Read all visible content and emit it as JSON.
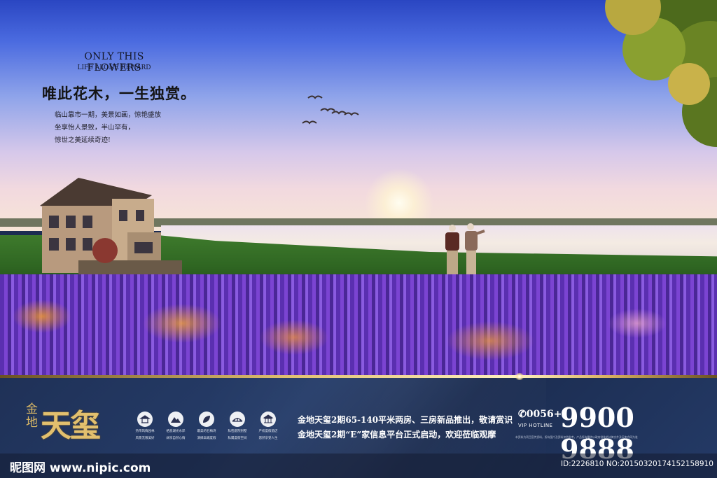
{
  "headline": {
    "en_title": "ONLY THIS FLOWERS",
    "en_sub": "LIFE ALONE REWARD",
    "cn_title": "唯此花木，一生独赏。",
    "desc_lines": [
      "临山靠市一期，美景如画，惊艳盛放",
      "坐享怡人景致，半山罕有，",
      "惊世之美延续奇迹!"
    ]
  },
  "logo": {
    "small": "金地",
    "big": "天玺"
  },
  "feature_icons": [
    {
      "icon": "pavilion-icon",
      "caption": [
        "热带风情园林",
        "风景无限美好"
      ]
    },
    {
      "icon": "mountain-icon",
      "caption": [
        "栖息湖光水岸",
        "阔享自然心情"
      ]
    },
    {
      "icon": "leaf-icon",
      "caption": [
        "最美的石梅湾",
        "演绎高端度假"
      ]
    },
    {
      "icon": "bridge-icon",
      "caption": [
        "私密庭院别墅",
        "私属度假空间"
      ]
    },
    {
      "icon": "temple-icon",
      "caption": [
        "产权度假酒店",
        "悠然享受人生"
      ]
    }
  ],
  "promo_lines": [
    "金地天玺2期65-140平米两房、三房新品推出，敬请赏识",
    "金地天玺2期“E”家信息平台正式启动，欢迎莅临观摩"
  ],
  "hotline": {
    "prefix": "✆0056+",
    "label": "VIP HOTLINE",
    "number": "9900 9888"
  },
  "fine_print": "本资料为项目宣传资料，所有图片及资料仅供参考，产品所有最终以政府批准的法律文件及买卖合同为准",
  "watermark": {
    "site": "昵图网 www.nipic.com",
    "id": "ID:2226810 NO:20150320174152158910"
  },
  "colors": {
    "band": "#1f3157",
    "gold": "#e0c070",
    "accent_purple": "#7b44d2"
  }
}
